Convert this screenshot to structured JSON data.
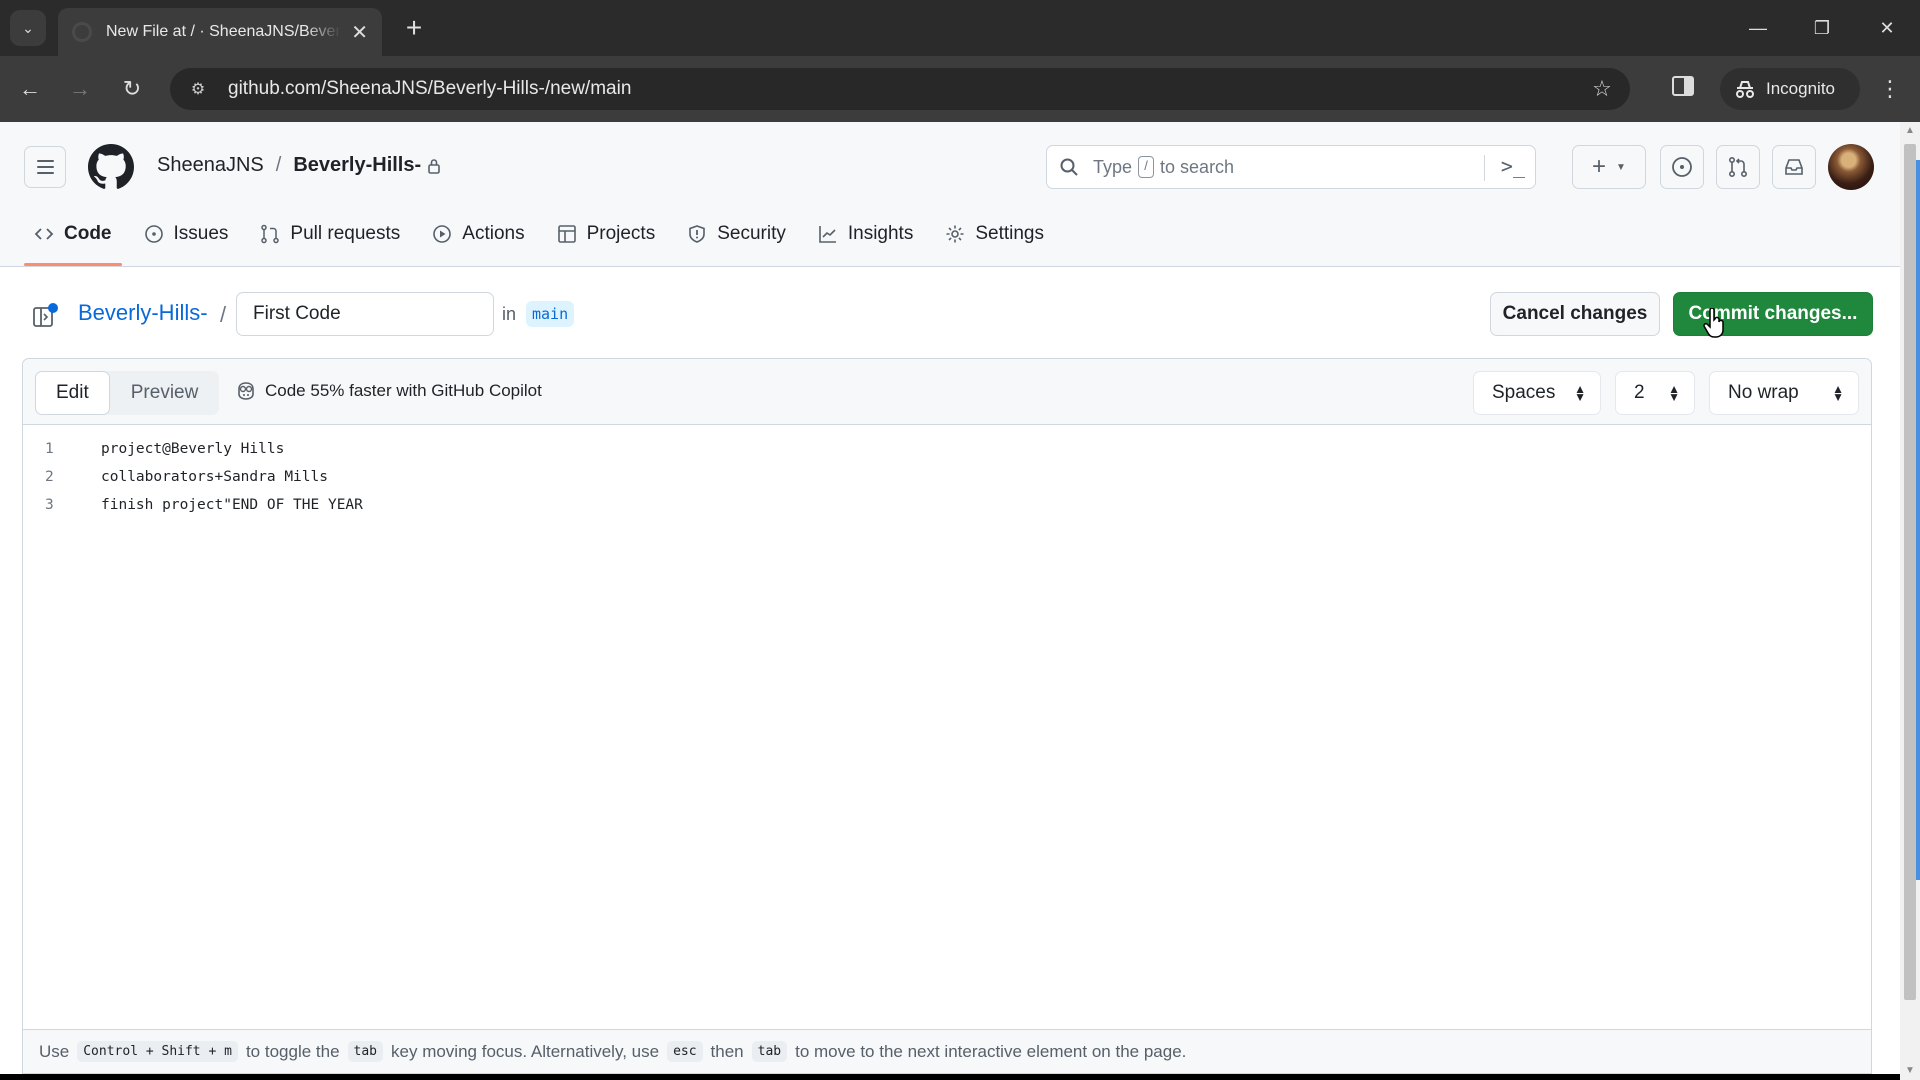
{
  "browser": {
    "tab_title": "New File at / · SheenaJNS/Beverly-Hills-",
    "url": "github.com/SheenaJNS/Beverly-Hills-/new/main",
    "incognito_label": "Incognito",
    "icons": {
      "tab_list": "chevron-down-icon",
      "new_tab": "plus-icon",
      "back": "arrow-left-icon",
      "forward": "arrow-right-icon",
      "reload": "reload-icon",
      "site_info": "tune-icon",
      "bookmark": "star-icon",
      "side_panel": "side-panel-icon",
      "menu": "kebab-icon"
    }
  },
  "header": {
    "owner": "SheenaJNS",
    "separator": "/",
    "repo": "Beverly-Hills-",
    "repo_private": true,
    "search_placeholder_before": "Type",
    "search_key": "/",
    "search_placeholder_after": "to search"
  },
  "repo_nav": {
    "items": [
      {
        "label": "Code",
        "icon": "code-icon",
        "active": true
      },
      {
        "label": "Issues",
        "icon": "issue-icon",
        "active": false
      },
      {
        "label": "Pull requests",
        "icon": "pull-request-icon",
        "active": false
      },
      {
        "label": "Actions",
        "icon": "play-icon",
        "active": false
      },
      {
        "label": "Projects",
        "icon": "table-icon",
        "active": false
      },
      {
        "label": "Security",
        "icon": "shield-icon",
        "active": false
      },
      {
        "label": "Insights",
        "icon": "graph-icon",
        "active": false
      },
      {
        "label": "Settings",
        "icon": "gear-icon",
        "active": false
      }
    ]
  },
  "file_bar": {
    "repo_link": "Beverly-Hills-",
    "slash": "/",
    "filename_value": "First Code",
    "in_label": "in",
    "branch": "main",
    "cancel_label": "Cancel changes",
    "commit_label": "Commit changes..."
  },
  "editor": {
    "tabs": [
      "Edit",
      "Preview"
    ],
    "active_tab": "Edit",
    "copilot_promo": "Code 55% faster with GitHub Copilot",
    "indent_mode": "Spaces",
    "indent_size": "2",
    "wrap_mode": "No wrap",
    "lines": [
      {
        "n": "1",
        "text": "project@Beverly Hills"
      },
      {
        "n": "2",
        "text": "collaborators+Sandra Mills"
      },
      {
        "n": "3",
        "text": "finish project\"END OF THE YEAR"
      }
    ]
  },
  "footer": {
    "t1": "Use",
    "k1": "Control + Shift + m",
    "t2": "to toggle the",
    "k2": "tab",
    "t3": "key moving focus. Alternatively, use",
    "k3": "esc",
    "t4": "then",
    "k4": "tab",
    "t5": "to move to the next interactive element on the page."
  },
  "colors": {
    "commit_green": "#1f883d",
    "link_blue": "#0969da",
    "active_underline": "#fd8c73"
  }
}
